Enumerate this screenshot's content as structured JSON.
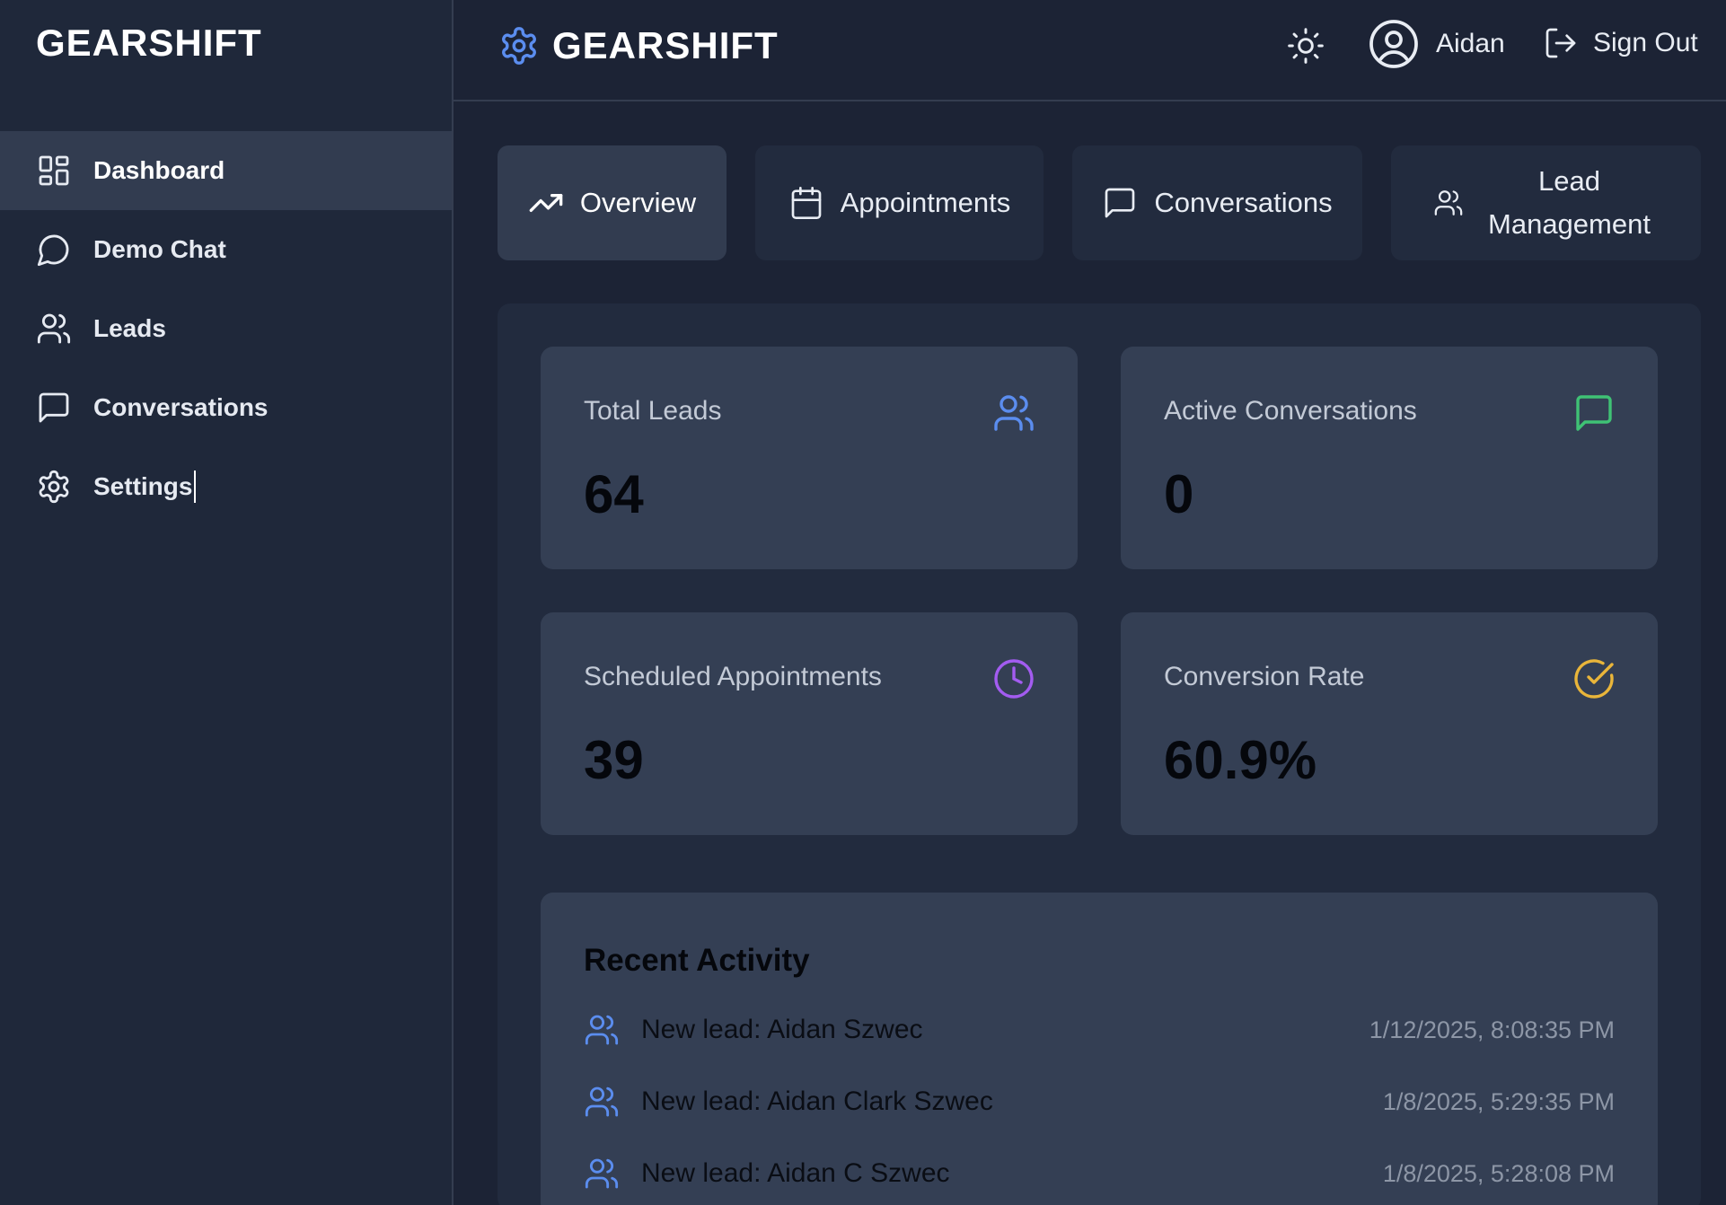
{
  "sidebar": {
    "brand": "GEARSHIFT",
    "items": [
      {
        "label": "Dashboard",
        "icon": "dashboard-grid-icon",
        "active": true
      },
      {
        "label": "Demo Chat",
        "icon": "chat-bubble-icon"
      },
      {
        "label": "Leads",
        "icon": "users-icon"
      },
      {
        "label": "Conversations",
        "icon": "message-square-icon"
      },
      {
        "label": "Settings",
        "icon": "gear-icon"
      }
    ]
  },
  "header": {
    "brand": "GEARSHIFT",
    "brand_icon": "gear-icon",
    "theme_icon": "sun-icon",
    "user_name": "Aidan",
    "user_icon": "user-circle-icon",
    "signout_label": "Sign Out",
    "signout_icon": "logout-icon"
  },
  "tabs": [
    {
      "label": "Overview",
      "icon": "trending-up-icon",
      "active": true
    },
    {
      "label": "Appointments",
      "icon": "calendar-icon"
    },
    {
      "label": "Conversations",
      "icon": "message-square-icon"
    },
    {
      "label": "Lead Management",
      "line1": "Lead",
      "line2": "Management",
      "icon": "users-icon"
    }
  ],
  "stats": [
    {
      "label": "Total Leads",
      "value": "64",
      "icon": "users-icon",
      "color": "#5b8def"
    },
    {
      "label": "Active Conversations",
      "value": "0",
      "icon": "message-square-icon",
      "color": "#3fc275"
    },
    {
      "label": "Scheduled Appointments",
      "value": "39",
      "icon": "clock-icon",
      "color": "#a35cf0"
    },
    {
      "label": "Conversion Rate",
      "value": "60.9%",
      "icon": "check-circle-icon",
      "color": "#e9b53a"
    }
  ],
  "activity": {
    "title": "Recent Activity",
    "items": [
      {
        "text": "New lead: Aidan Szwec",
        "time": "1/12/2025, 8:08:35 PM"
      },
      {
        "text": "New lead: Aidan Clark Szwec",
        "time": "1/8/2025, 5:29:35 PM"
      },
      {
        "text": "New lead: Aidan C Szwec",
        "time": "1/8/2025, 5:28:08 PM"
      }
    ]
  },
  "colors": {
    "accent_blue": "#5b8def",
    "background": "#1c2335",
    "sidebar": "#1f283a",
    "card": "#343f54"
  }
}
